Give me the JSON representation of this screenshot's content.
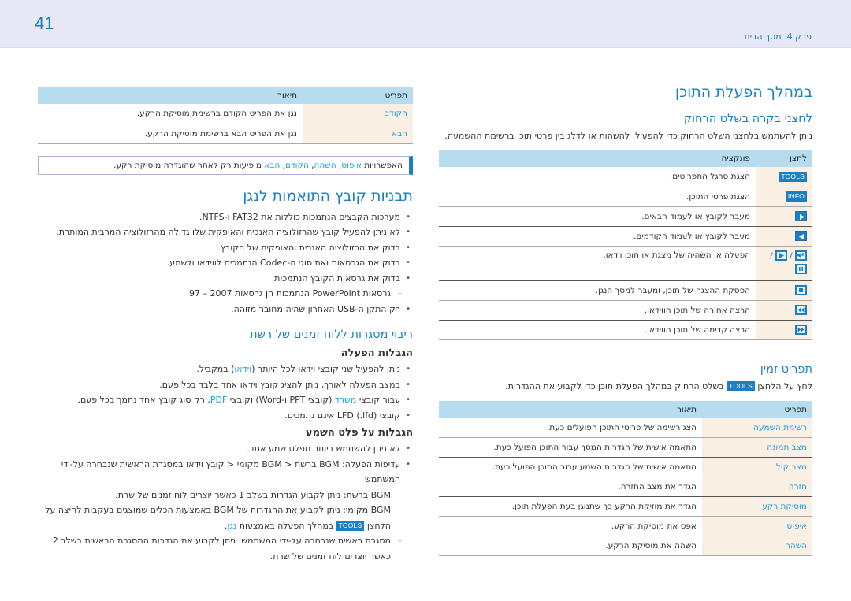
{
  "header": {
    "page_number": "41",
    "chapter": "פרק 4. מסך הבית"
  },
  "right": {
    "title": "במהלך הפעלת התוכן",
    "remote_section": {
      "heading": "לחצני בקרה בשלט הרחוק",
      "description": "ניתן להשתמש בלחצני השלט הרחוק כדי להפעיל, להשהות או לדלג בין פרטי תוכן ברשימת ההשמעה.",
      "table_headers": [
        "לחצן",
        "פונקציה"
      ],
      "rows": [
        {
          "button": "TOOLS",
          "button_type": "tools-key",
          "function": "הצגת סרגל התפריטים."
        },
        {
          "button": "INFO",
          "button_type": "info-key",
          "function": "הצגת פרטי התוכן."
        },
        {
          "button": "next",
          "button_type": "right-arrow-icon",
          "function": "מעבר לקובץ או לעמוד הבאים."
        },
        {
          "button": "previous",
          "button_type": "left-arrow-icon",
          "function": "מעבר לקובץ או לעמוד הקודמים."
        },
        {
          "button": "enter / play / pause",
          "button_type": "play-pause-icons",
          "function": "הפעלה או השהיה של מצגת או תוכן וידאו.",
          "separator": "/"
        },
        {
          "button": "stop",
          "button_type": "stop-icon",
          "function": "הפסקת ההצגה של תוכן, ומעבר למסך הנגן."
        },
        {
          "button": "rewind",
          "button_type": "rewind-icon",
          "function": "הרצה אחורה של תוכן הווידאו."
        },
        {
          "button": "fast-forward",
          "button_type": "fast-forward-icon",
          "function": "הרצה קדימה של תוכן הווידאו."
        }
      ]
    },
    "menu_section": {
      "heading": "תפריט זמין",
      "description_before": "לחץ על הלחצן",
      "description_key": "TOOLS",
      "description_after": "בשלט הרחוק במהלך הפעלת תוכן כדי לקבוע את ההגדרות.",
      "table_headers": [
        "תפריט",
        "תיאור"
      ],
      "rows": [
        {
          "item": "רשימת השמעה",
          "description": "הצג רשימה של פריטי התוכן הפועלים כעת."
        },
        {
          "item": "מצב תמונה",
          "description": "התאמה אישית של הגדרות המסך עבור התוכן הפועל כעת."
        },
        {
          "item": "מצב קול",
          "description": "התאמה אישית של הגדרות השמע עבור התוכן הפועל כעת."
        },
        {
          "item": "חזרה",
          "description": "הגדר את מצב החזרה."
        },
        {
          "item": "מוסיקת רקע",
          "description": "הגדר את מוזיקת הרקע כך שתנוגן בעת הפעלת תוכן."
        },
        {
          "item": "איפוס",
          "description": "אפס את מוסיקת הרקע."
        },
        {
          "item": "השהה",
          "description": "השהה את מוסיקת הרקע."
        }
      ]
    }
  },
  "left": {
    "table_headers": [
      "תפריט",
      "תיאור"
    ],
    "rows": [
      {
        "item": "הקודם",
        "description": "נגן את הפריט הקודם ברשימת מוסיקת הרקע."
      },
      {
        "item": "הבא",
        "description": "נגן את הפריט הבא ברשימת מוסיקת הרקע."
      }
    ],
    "note": {
      "prefix": "האפשרויות",
      "opt1": "איפוס",
      "opt2": "השהה",
      "opt3": "הקודם",
      "opt4": "הבא",
      "comma": ", ",
      "suffix": "מופיעות רק לאחר שהוגדרה מוסיקת רקע."
    },
    "formats_section": {
      "heading": "תבניות קובץ התואמות לנגן",
      "bullets": [
        "מערכות הקבצים הנתמכות כוללות את FAT32 ו-NTFS.",
        "לא ניתן להפעיל קובץ שהרזולוציה האנכית והאופקית שלו גדולה מהרזולוציה המרבית המותרת.",
        "בדוק את הרזולוציה האנכית והאופקית של הקובץ.",
        "בדוק את הגרסאות ואת סוגי ה-Codec הנתמכים לווידאו ולשמע.",
        "בדוק את גרסאות הקובץ הנתמכות."
      ],
      "sub_bullet": "גרסאות PowerPoint הנתמכות הן גרסאות 2007 – 97",
      "last_bullet": "רק התקן ה-USB האחרון שהיה מחובר מזוהה."
    },
    "multi_frame_section": {
      "heading": "ריבוי מסגרות ללוח זמנים של רשת",
      "playback_heading": "הגבלות הפעלה",
      "playback_b1_before": "ניתן להפעיל שני קובצי וידאו לכל היותר (",
      "playback_b1_hl": "וידאו",
      "playback_b1_after": ") במקביל.",
      "playback_b2": "במצב הפעלה לאורך, ניתן להציג קובץ וידאו אחד בלבד בכל פעם.",
      "playback_b3_before": "עבור קובצי ",
      "playback_b3_hl1": "משרד",
      "playback_b3_mid": " (קובצי PPT ו-Word) וקובצי ",
      "playback_b3_hl2": "PDF",
      "playback_b3_after": ", רק סוג קובץ אחד נתמך בכל פעם.",
      "playback_b4": "קובצי LFD (.lfd) אינם נתמכים.",
      "audio_heading": "הגבלות על פלט השמע",
      "audio_b1": "לא ניתן להשתמש ביותר מפלט שמע אחד.",
      "audio_b2": "עדיפות הפעלה: BGM ברשת < BGM מקומי < קובץ וידאו במסגרת הראשית שנבחרה על-ידי המשתמש",
      "audio_sub1": "BGM ברשת: ניתן לקבוע הגדרות בשלב 1 כאשר יוצרים לוח זמנים של שרת.",
      "audio_sub2_before": "BGM מקומי: ניתן לקבוע את ההגדרות של BGM באמצעות הכלים שמוצגים בעקבות לחיצה על הלחצן ",
      "audio_sub2_key": "TOOLS",
      "audio_sub2_mid": " במהלך הפעלה באמצעות ",
      "audio_sub2_hl": "נגן",
      "audio_sub2_after": ".",
      "audio_sub3": "מסגרת ראשית שנבחרה על-ידי המשתמש: ניתן לקבוע את הגדרות המסגרת הראשית בשלב 2 כאשר יוצרים לוח זמנים של שרת."
    }
  }
}
